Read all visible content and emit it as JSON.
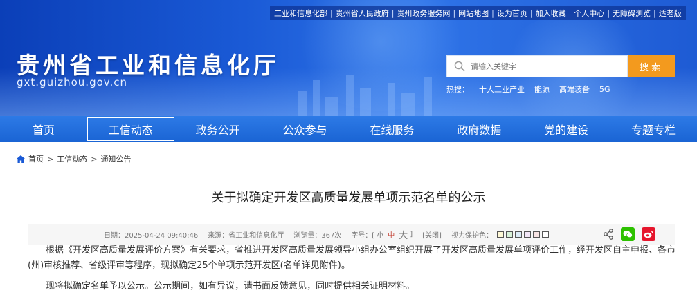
{
  "top_links": [
    "工业和信息化部",
    "贵州省人民政府",
    "贵州政务服务网",
    "网站地图",
    "设为首页",
    "加入收藏",
    "个人中心",
    "无障碍浏览",
    "适老版"
  ],
  "site": {
    "title": "贵州省工业和信息化厅",
    "domain": "gxt.guizhou.gov.cn"
  },
  "search": {
    "placeholder": "请输入关键字",
    "button_label": "搜索"
  },
  "hot": {
    "label": "热搜：",
    "words": [
      "十大工业产业",
      "能源",
      "高端装备",
      "5G"
    ]
  },
  "nav": {
    "items": [
      "首页",
      "工信动态",
      "政务公开",
      "公众参与",
      "在线服务",
      "政府数据",
      "党的建设",
      "专题专栏"
    ],
    "active_index": 1
  },
  "breadcrumb": {
    "items": [
      "首页",
      "工信动态",
      "通知公告"
    ],
    "separator": ">"
  },
  "article": {
    "title": "关于拟确定开发区高质量发展单项示范名单的公示",
    "meta": {
      "date": "日期：2025-04-24 09:40:46",
      "source": "来源：省工业和信息化厅",
      "views": "浏览量：367次",
      "font_label": "字号：[",
      "font_small": "小",
      "font_mid": "中",
      "font_big": "大",
      "font_close": "]",
      "close": "[关闭]",
      "eye_care": "视力保护色："
    },
    "swatch_colors": [
      "#fff9d6",
      "#d9f2d9",
      "#dcebf7",
      "#f2e6f7",
      "#f7e3e3",
      "#ffffff"
    ],
    "paragraphs": [
      "根据《开发区高质量发展评价方案》有关要求，省推进开发区高质量发展领导小组办公室组织开展了开发区高质量发展单项评价工作，经开发区自主申报、各市(州)审核推荐、省级评审等程序，现拟确定25个单项示范开发区(名单详见附件)。",
      "现将拟确定名单予以公示。公示期间，如有异议，请书面反馈意见，同时提供相关证明材料。"
    ]
  },
  "colors": {
    "nav_blue": "#1a64d4",
    "search_orange": "#f39a1e",
    "wechat_green": "#2dc100",
    "weibo_red": "#e6162d"
  }
}
